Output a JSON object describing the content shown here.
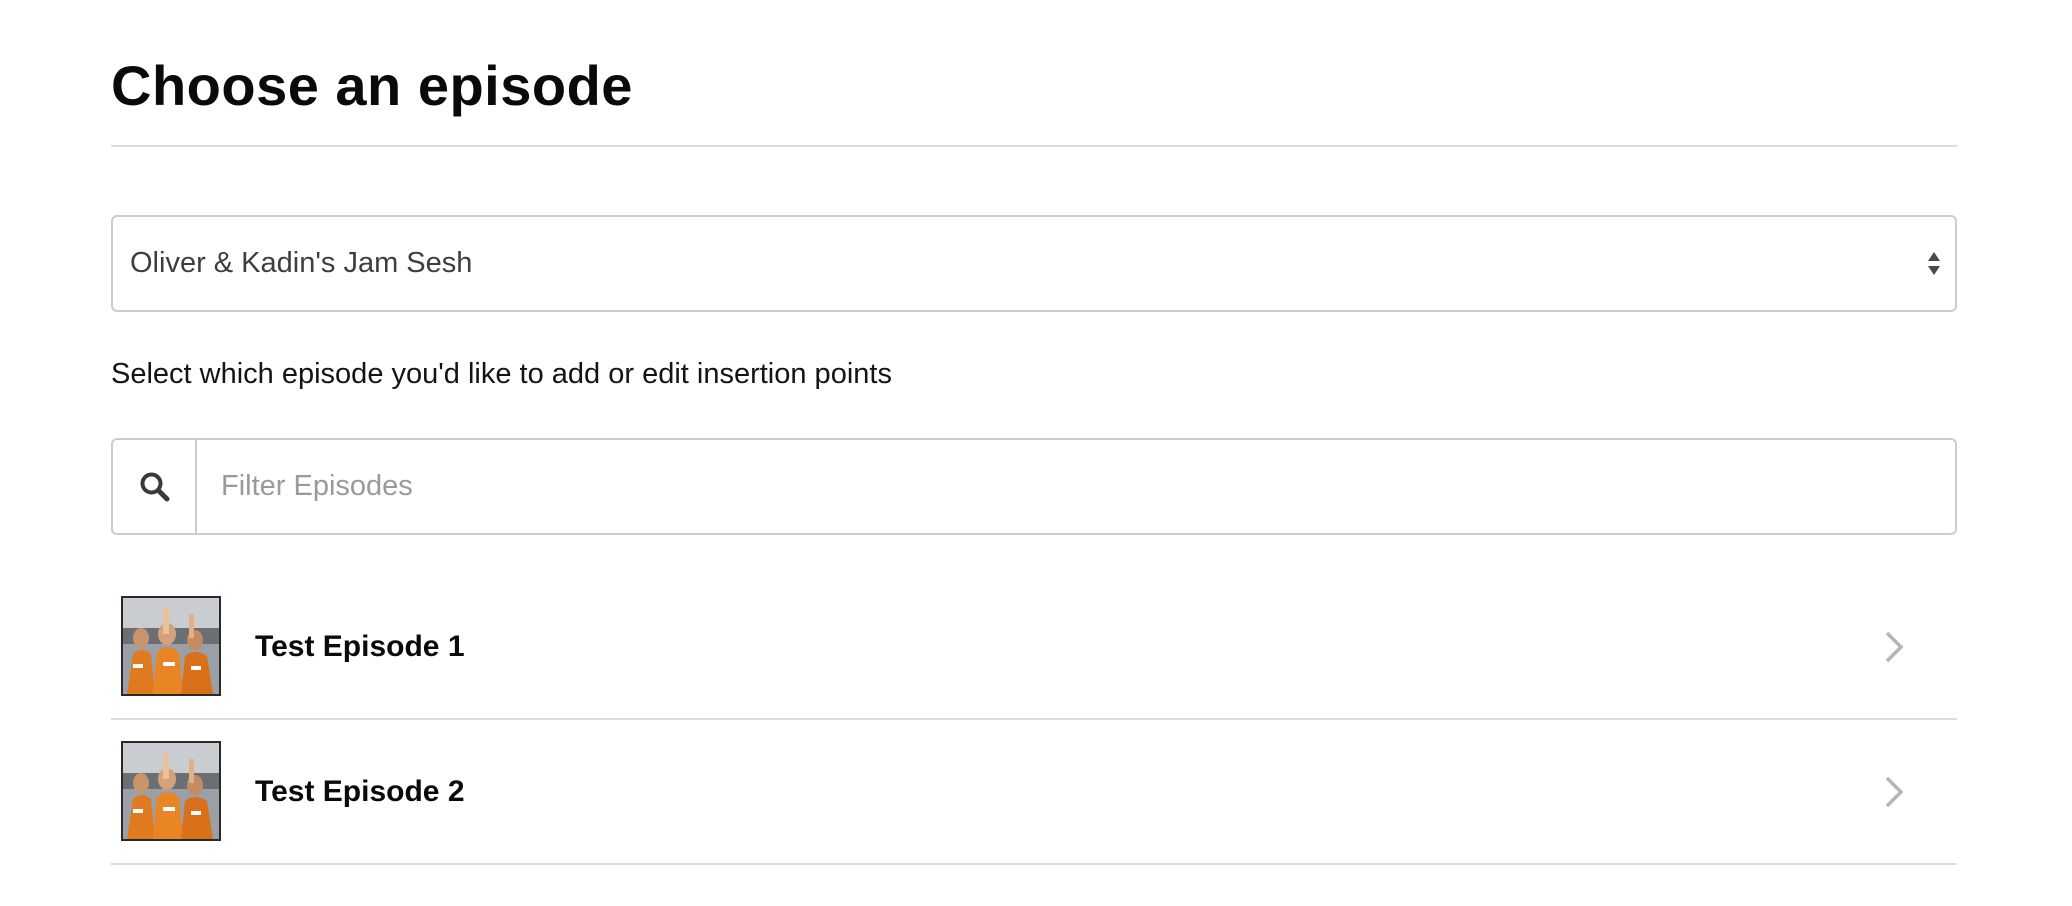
{
  "page": {
    "title": "Choose an episode"
  },
  "podcast_select": {
    "selected_value": "Oliver & Kadin's Jam Sesh",
    "icon": "sort-arrows-icon"
  },
  "help_text": "Select which episode you'd like to add or edit insertion points",
  "filter": {
    "icon": "search-icon",
    "placeholder": "Filter Episodes",
    "value": ""
  },
  "episodes": [
    {
      "title": "Test Episode 1",
      "thumbnail": "episode-artwork",
      "chevron": "chevron-right-icon"
    },
    {
      "title": "Test Episode 2",
      "thumbnail": "episode-artwork",
      "chevron": "chevron-right-icon"
    }
  ],
  "colors": {
    "border": "#cccccc",
    "divider": "#dcdcdc",
    "text": "#0a0a0a",
    "placeholder": "#9a9a9a",
    "chevron": "#b5b5b5",
    "thumbnail_accent": "#e07a1f"
  }
}
